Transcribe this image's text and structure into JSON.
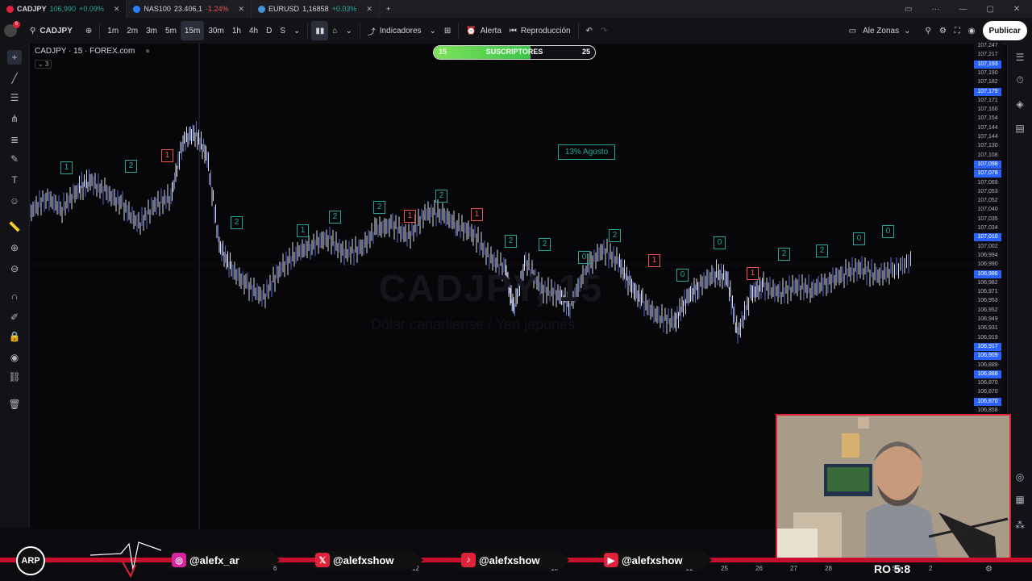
{
  "tabs": [
    {
      "symbol": "CADJPY",
      "price": "106,990",
      "change": "+0.09%",
      "dir": "up",
      "active": true
    },
    {
      "symbol": "NAS100",
      "price": "23.406,1",
      "change": "-1.24%",
      "dir": "down",
      "active": false
    },
    {
      "symbol": "EURUSD",
      "price": "1,16858",
      "change": "+0.03%",
      "dir": "up",
      "active": false
    }
  ],
  "toolbar": {
    "symbol": "CADJPY",
    "intervals": [
      "1m",
      "2m",
      "3m",
      "5m",
      "15m",
      "30m",
      "1h",
      "4h",
      "D",
      "S"
    ],
    "selected_interval": "15m",
    "indicators": "Indicadores",
    "alert": "Alerta",
    "replay": "Reproducción",
    "layout_name": "Ale Zonas",
    "publish": "Publicar"
  },
  "chart": {
    "title": "CADJPY · 15 · FOREX.com",
    "collapse_count": "3",
    "note": "13% Agosto",
    "watermark": "CADJPY, 15",
    "watermark_sub": "Dólar canadiense / Yen japonés"
  },
  "subscribers": {
    "label": "SUSCRIPTORES",
    "current": "15",
    "goal": "25",
    "fraction": 0.6
  },
  "price_axis": [
    "107,247",
    "107,217",
    "107,193",
    "107,190",
    "107,182",
    "107,179",
    "107,171",
    "107,160",
    "107,154",
    "107,144",
    "107,144",
    "107,130",
    "107,108",
    "107,098",
    "107,078",
    "107,069",
    "107,053",
    "107,052",
    "107,040",
    "107,035",
    "107,034",
    "107,010",
    "107,002",
    "106,994",
    "106,990",
    "106,986",
    "106,982",
    "106,971",
    "106,953",
    "106,952",
    "106,949",
    "106,931",
    "106,919",
    "106,917",
    "106,909",
    "106,889",
    "106,888",
    "106,870",
    "106,870",
    "106,870",
    "106,858"
  ],
  "price_axis_highlight": [
    2,
    5,
    13,
    14,
    21,
    25,
    33,
    34,
    36,
    39
  ],
  "time_axis": [
    "6",
    "12",
    "18",
    "22",
    "25",
    "26",
    "27",
    "28",
    "Sep",
    "2"
  ],
  "wave_labels": [
    {
      "t": "1",
      "c": "g"
    },
    {
      "t": "2",
      "c": "g"
    },
    {
      "t": "1",
      "c": "r"
    },
    {
      "t": "2",
      "c": "g"
    },
    {
      "t": "1",
      "c": "g"
    },
    {
      "t": "2",
      "c": "g"
    },
    {
      "t": "2",
      "c": "g"
    },
    {
      "t": "1",
      "c": "r"
    },
    {
      "t": "2",
      "c": "g"
    },
    {
      "t": "1",
      "c": "r"
    },
    {
      "t": "2",
      "c": "g"
    },
    {
      "t": "2",
      "c": "g"
    },
    {
      "t": "0",
      "c": "g"
    },
    {
      "t": "2",
      "c": "g"
    },
    {
      "t": "1",
      "c": "r"
    },
    {
      "t": "0",
      "c": "g"
    },
    {
      "t": "0",
      "c": "g"
    },
    {
      "t": "1",
      "c": "r"
    },
    {
      "t": "2",
      "c": "g"
    },
    {
      "t": "2",
      "c": "g"
    },
    {
      "t": "0",
      "c": "g"
    },
    {
      "t": "0",
      "c": "g"
    }
  ],
  "social": [
    {
      "network": "instagram",
      "handle": "@alefx_ar",
      "color": "#d6249f"
    },
    {
      "network": "x",
      "handle": "@alefxshow",
      "color": "#e0223a"
    },
    {
      "network": "tiktok",
      "handle": "@alefxshow",
      "color": "#e0223a"
    },
    {
      "network": "youtube",
      "handle": "@alefxshow",
      "color": "#e0223a"
    }
  ],
  "overlay_score": "RO 5:8",
  "colors": {
    "up": "#26a69a",
    "down": "#ef5350",
    "accent": "#2962ff",
    "brand_red": "#c8102e"
  }
}
